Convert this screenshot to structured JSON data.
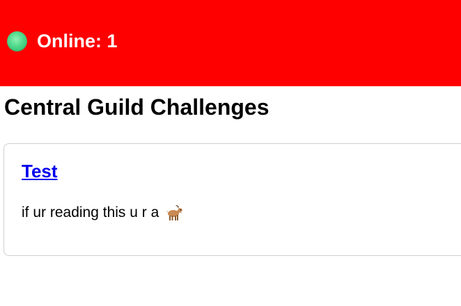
{
  "header": {
    "status_label": "Online: 1",
    "status_color": "#4fd88a",
    "background_color": "#ff0000"
  },
  "page": {
    "title": "Central Guild Challenges"
  },
  "challenges": [
    {
      "title": "Test",
      "description": "if ur reading this u r a",
      "emoji_icon": "goat-icon"
    }
  ]
}
